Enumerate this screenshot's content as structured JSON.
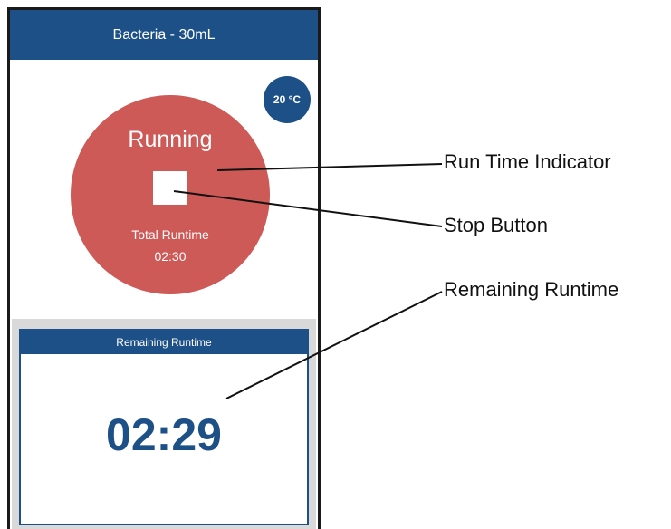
{
  "app": {
    "title": "Bacteria - 30mL",
    "temperature": "20 °C"
  },
  "run_indicator": {
    "status": "Running",
    "total_runtime_label": "Total Runtime",
    "total_runtime_value": "02:30"
  },
  "remaining": {
    "header": "Remaining Runtime",
    "value": "02:29"
  },
  "callouts": {
    "run_time_indicator": "Run Time Indicator",
    "stop_button": "Stop Button",
    "remaining_runtime": "Remaining Runtime"
  },
  "colors": {
    "primary": "#1e5088",
    "running": "#cd5a57"
  }
}
